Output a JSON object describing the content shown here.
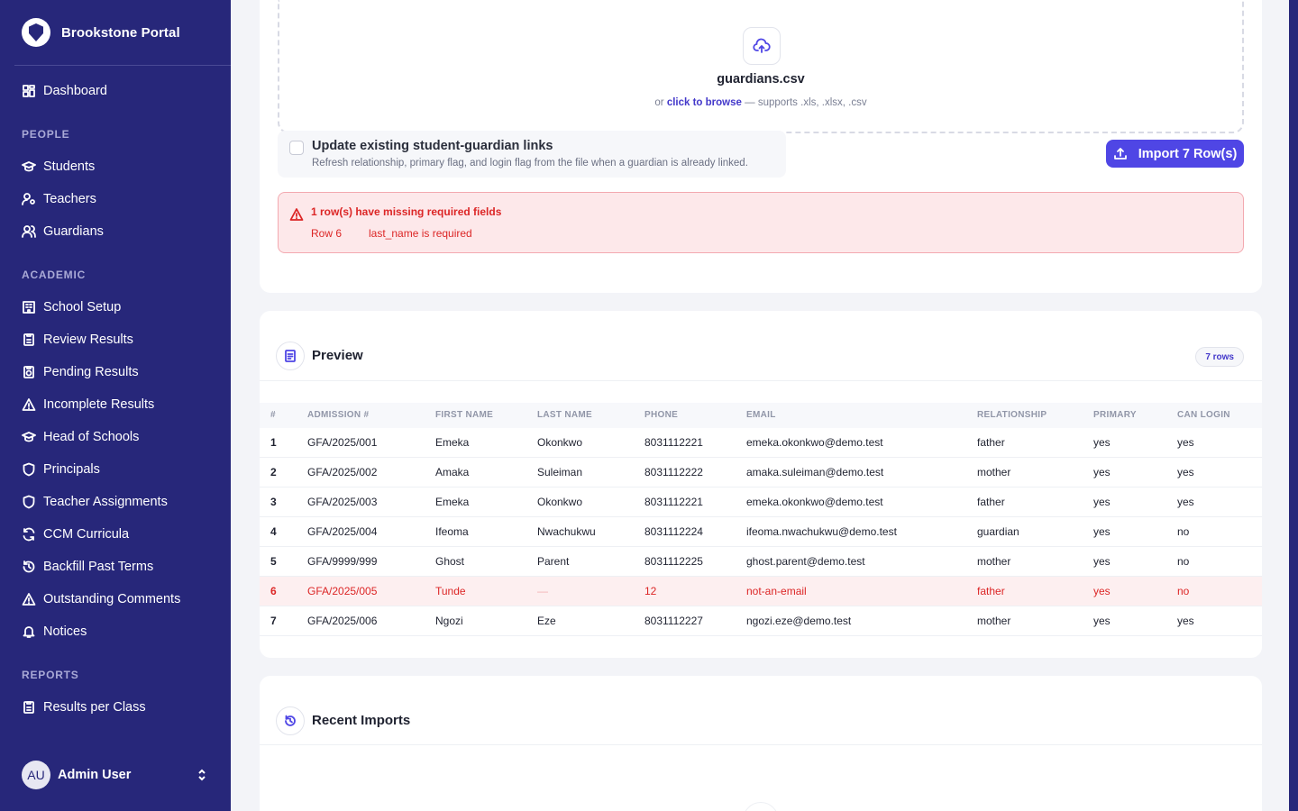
{
  "sidebar": {
    "brand": "Brookstone Portal",
    "dashboard": "Dashboard",
    "sections": {
      "people": "PEOPLE",
      "academic": "ACADEMIC",
      "reports": "REPORTS"
    },
    "people_items": [
      "Students",
      "Teachers",
      "Guardians"
    ],
    "academic_items": [
      "School Setup",
      "Review Results",
      "Pending Results",
      "Incomplete Results",
      "Head of Schools",
      "Principals",
      "Teacher Assignments",
      "CCM Curricula",
      "Backfill Past Terms",
      "Outstanding Comments",
      "Notices"
    ],
    "reports_items": [
      "Results per Class"
    ],
    "user": {
      "initials": "AU",
      "name": "Admin User"
    }
  },
  "upload": {
    "file_name": "guardians.csv",
    "browse_prefix": "or",
    "browse_link": "click to browse",
    "browse_suffix": "— supports .xls, .xlsx, .csv",
    "update_title": "Update existing student-guardian links",
    "update_sub": "Refresh relationship, primary flag, and login flag from the file when a guardian is already linked.",
    "import_label": "Import 7 Row(s)"
  },
  "alert": {
    "title": "1 row(s) have missing required fields",
    "row": "Row 6",
    "message": "last_name is required"
  },
  "preview": {
    "title": "Preview",
    "badge": "7 rows",
    "columns": [
      "#",
      "ADMISSION #",
      "FIRST NAME",
      "LAST NAME",
      "PHONE",
      "EMAIL",
      "RELATIONSHIP",
      "PRIMARY",
      "CAN LOGIN"
    ],
    "rows": [
      [
        "1",
        "GFA/2025/001",
        "Emeka",
        "Okonkwo",
        "8031112221",
        "emeka.okonkwo@demo.test",
        "father",
        "yes",
        "yes"
      ],
      [
        "2",
        "GFA/2025/002",
        "Amaka",
        "Suleiman",
        "8031112222",
        "amaka.suleiman@demo.test",
        "mother",
        "yes",
        "yes"
      ],
      [
        "3",
        "GFA/2025/003",
        "Emeka",
        "Okonkwo",
        "8031112221",
        "emeka.okonkwo@demo.test",
        "father",
        "yes",
        "yes"
      ],
      [
        "4",
        "GFA/2025/004",
        "Ifeoma",
        "Nwachukwu",
        "8031112224",
        "ifeoma.nwachukwu@demo.test",
        "guardian",
        "yes",
        "no"
      ],
      [
        "5",
        "GFA/9999/999",
        "Ghost",
        "Parent",
        "8031112225",
        "ghost.parent@demo.test",
        "mother",
        "yes",
        "no"
      ],
      [
        "6",
        "GFA/2025/005",
        "Tunde",
        "—",
        "12",
        "not-an-email",
        "father",
        "yes",
        "no"
      ],
      [
        "7",
        "GFA/2025/006",
        "Ngozi",
        "Eze",
        "8031112227",
        "ngozi.eze@demo.test",
        "mother",
        "yes",
        "yes"
      ]
    ],
    "error_row_index": 5
  },
  "recent": {
    "title": "Recent Imports"
  },
  "colors": {
    "sidebar": "#27277a",
    "accent": "#4f46e5",
    "error": "#dc2626"
  }
}
